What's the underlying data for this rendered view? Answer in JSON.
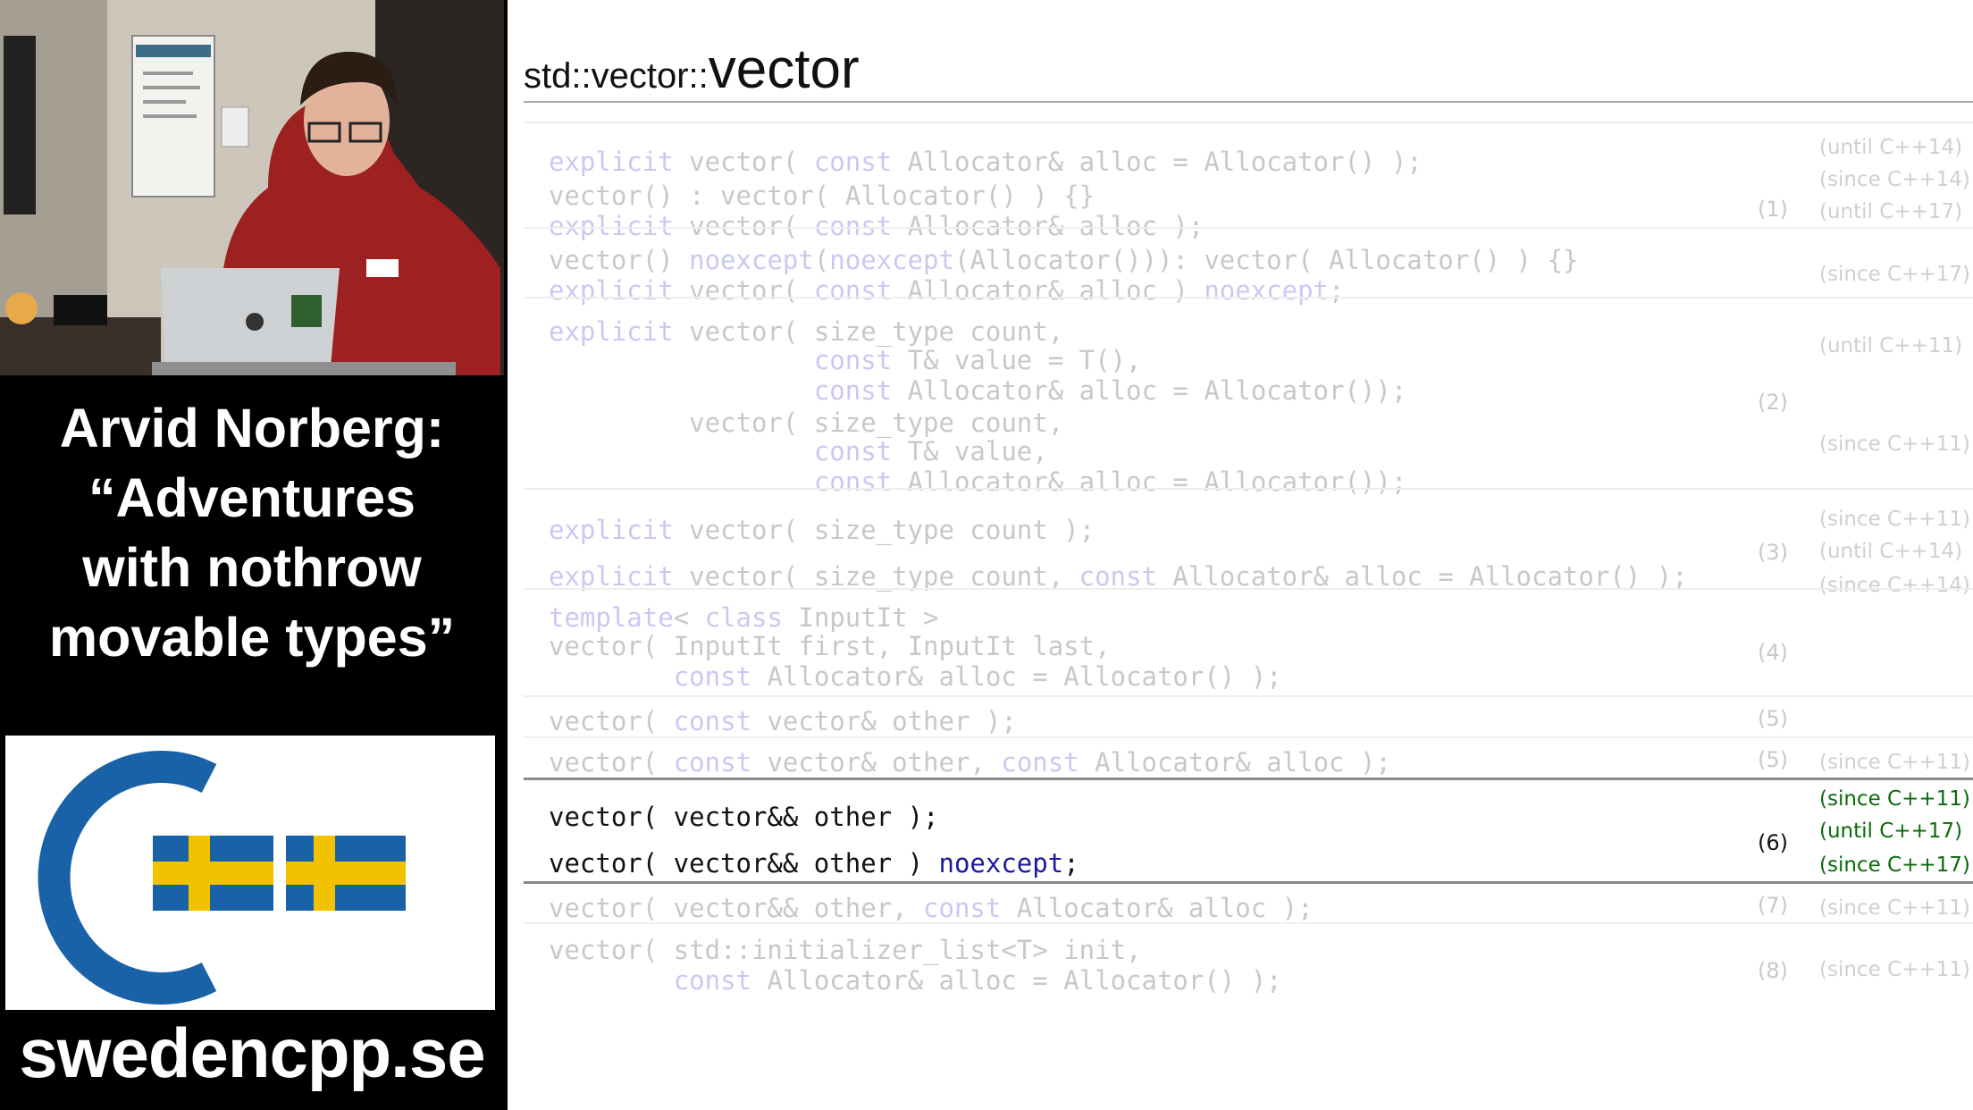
{
  "caption": {
    "lines": [
      "Arvid Norberg:",
      "“Adventures",
      "with nothrow",
      "movable types”"
    ]
  },
  "website": "swedencpp.se",
  "colors": {
    "logo_blue": "#1a62a8",
    "logo_yellow": "#f2c100",
    "keyword_dim": "#c9c9f2",
    "keyword_bright": "#1a1a9e",
    "version_green": "#0a6b0a"
  },
  "slide": {
    "title_prefix": "std::vector::",
    "title_main": "vector",
    "rows": [
      {
        "lines": [
          {
            "parts": [
              {
                "t": "explicit",
                "k": true
              },
              {
                "t": " vector( "
              },
              {
                "t": "const",
                "k": true
              },
              {
                "t": " Allocator& alloc = Allocator() );"
              }
            ]
          },
          {
            "parts": [
              {
                "t": "vector() : vector( Allocator() ) {}"
              }
            ]
          },
          {
            "parts": [
              {
                "t": "explicit",
                "k": true
              },
              {
                "t": " vector( "
              },
              {
                "t": "const",
                "k": true
              },
              {
                "t": " Allocator& alloc );"
              }
            ]
          }
        ],
        "num": "(1)",
        "versions": [
          "(until C++14)",
          "(since C++14)",
          "(until C++17)"
        ]
      },
      {
        "lines": [
          {
            "parts": [
              {
                "t": "vector() "
              },
              {
                "t": "noexcept",
                "k": true
              },
              {
                "t": "("
              },
              {
                "t": "noexcept",
                "k": true
              },
              {
                "t": "(Allocator())): vector( Allocator() ) {}"
              }
            ]
          },
          {
            "parts": [
              {
                "t": "explicit",
                "k": true
              },
              {
                "t": " vector( "
              },
              {
                "t": "const",
                "k": true
              },
              {
                "t": " Allocator& alloc ) "
              },
              {
                "t": "noexcept",
                "k": true
              },
              {
                "t": ";"
              }
            ]
          }
        ],
        "versions": [
          "(since C++17)"
        ]
      },
      {
        "lines": [
          {
            "parts": [
              {
                "t": "explicit",
                "k": true
              },
              {
                "t": " vector( size_type count,"
              }
            ]
          },
          {
            "parts": [
              {
                "t": "                 "
              },
              {
                "t": "const",
                "k": true
              },
              {
                "t": " T& value = T(),"
              }
            ]
          },
          {
            "parts": [
              {
                "t": "                 "
              },
              {
                "t": "const",
                "k": true
              },
              {
                "t": " Allocator& alloc = Allocator());"
              }
            ]
          },
          {
            "parts": [
              {
                "t": "         vector( size_type count,"
              }
            ]
          },
          {
            "parts": [
              {
                "t": "                 "
              },
              {
                "t": "const",
                "k": true
              },
              {
                "t": " T& value,"
              }
            ]
          },
          {
            "parts": [
              {
                "t": "                 "
              },
              {
                "t": "const",
                "k": true
              },
              {
                "t": " Allocator& alloc = Allocator());"
              }
            ]
          }
        ],
        "num": "(2)",
        "versions": [
          "(until C++11)",
          "(since C++11)"
        ]
      },
      {
        "lines": [
          {
            "parts": [
              {
                "t": "explicit",
                "k": true
              },
              {
                "t": " vector( size_type count );"
              }
            ]
          },
          {
            "parts": [
              {
                "t": "explicit",
                "k": true
              },
              {
                "t": " vector( size_type count, "
              },
              {
                "t": "const",
                "k": true
              },
              {
                "t": " Allocator& alloc = Allocator() );"
              }
            ]
          }
        ],
        "num": "(3)",
        "versions": [
          "(since C++11)",
          "(until C++14)",
          "(since C++14)"
        ]
      },
      {
        "lines": [
          {
            "parts": [
              {
                "t": "template",
                "k": true
              },
              {
                "t": "< "
              },
              {
                "t": "class",
                "k": true
              },
              {
                "t": " InputIt >"
              }
            ]
          },
          {
            "parts": [
              {
                "t": "vector( InputIt first, InputIt last,"
              }
            ]
          },
          {
            "parts": [
              {
                "t": "        "
              },
              {
                "t": "const",
                "k": true
              },
              {
                "t": " Allocator& alloc = Allocator() );"
              }
            ]
          }
        ],
        "num": "(4)"
      },
      {
        "lines": [
          {
            "parts": [
              {
                "t": "vector( "
              },
              {
                "t": "const",
                "k": true
              },
              {
                "t": " vector& other );"
              }
            ]
          }
        ],
        "num": "(5)"
      },
      {
        "lines": [
          {
            "parts": [
              {
                "t": "vector( "
              },
              {
                "t": "const",
                "k": true
              },
              {
                "t": " vector& other, "
              },
              {
                "t": "const",
                "k": true
              },
              {
                "t": " Allocator& alloc );"
              }
            ]
          }
        ],
        "num": "(5)",
        "versions": [
          "(since C++11)"
        ]
      },
      {
        "lines": [
          {
            "parts": [
              {
                "t": "vector( vector&& other );"
              }
            ]
          },
          {
            "parts": [
              {
                "t": "vector( vector&& other ) "
              },
              {
                "t": "noexcept",
                "k": true
              },
              {
                "t": ";"
              }
            ]
          }
        ],
        "num": "(6)",
        "versions": [
          "(since C++11)",
          "(until C++17)",
          "(since C++17)"
        ]
      },
      {
        "lines": [
          {
            "parts": [
              {
                "t": "vector( vector&& other, "
              },
              {
                "t": "const",
                "k": true
              },
              {
                "t": " Allocator& alloc );"
              }
            ]
          }
        ],
        "num": "(7)",
        "versions": [
          "(since C++11)"
        ]
      },
      {
        "lines": [
          {
            "parts": [
              {
                "t": "vector( std::initializer_list<T> init,"
              }
            ]
          },
          {
            "parts": [
              {
                "t": "        "
              },
              {
                "t": "const",
                "k": true
              },
              {
                "t": " Allocator& alloc = Allocator() );"
              }
            ]
          }
        ],
        "num": "(8)",
        "versions": [
          "(since C++11)"
        ]
      }
    ]
  }
}
